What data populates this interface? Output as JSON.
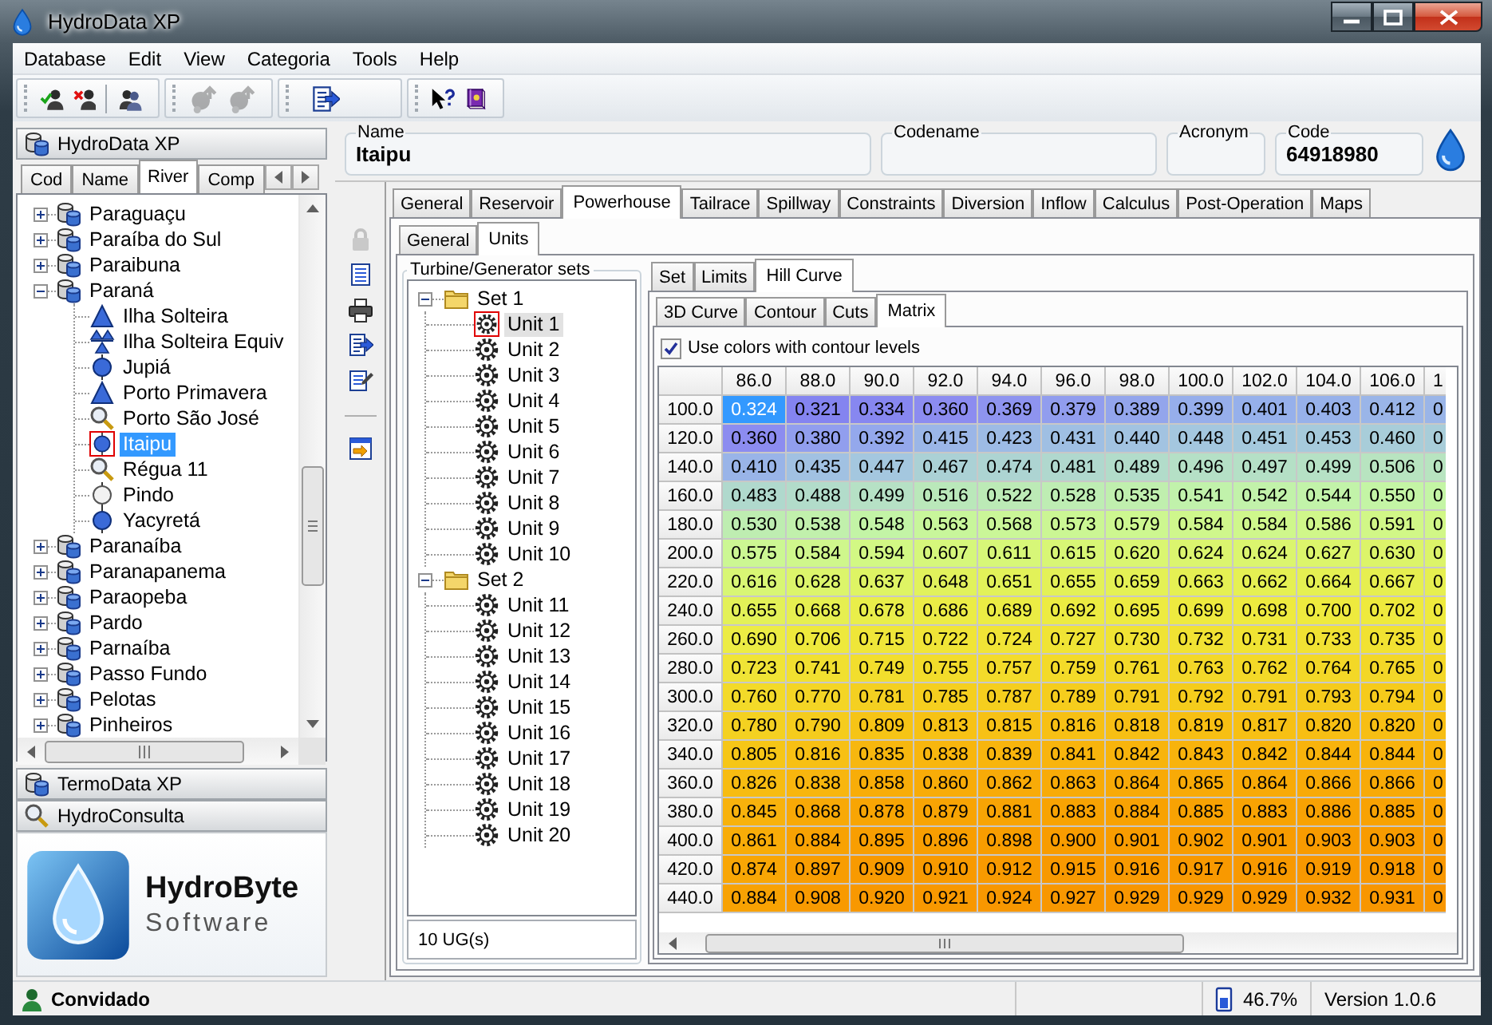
{
  "window": {
    "title": "HydroData XP"
  },
  "menu": {
    "items": [
      "Database",
      "Edit",
      "View",
      "Categoria",
      "Tools",
      "Help"
    ]
  },
  "toolbar": {
    "groups": [
      [
        {
          "disabled": false
        },
        {
          "disabled": false
        },
        {
          "disabled": false
        }
      ],
      [
        {
          "disabled": true
        },
        {
          "disabled": true
        }
      ],
      [
        {
          "disabled": false
        }
      ],
      [
        {
          "disabled": false
        },
        {
          "disabled": false
        }
      ]
    ]
  },
  "sidebar": {
    "title": "HydroData XP",
    "tabs": [
      {
        "label": "Cod",
        "selected": false
      },
      {
        "label": "Name",
        "selected": false
      },
      {
        "label": "River",
        "selected": true
      },
      {
        "label": "Comp",
        "selected": false
      }
    ],
    "tree": [
      {
        "label": "Paraguaçu",
        "expanded": false,
        "selected": false
      },
      {
        "label": "Paraíba do Sul",
        "expanded": false,
        "selected": false
      },
      {
        "label": "Paraibuna",
        "expanded": false,
        "selected": false
      },
      {
        "label": "Paraná",
        "expanded": true,
        "selected": false,
        "children": [
          {
            "label": "Ilha Solteira",
            "kind": "triangle",
            "selected": false
          },
          {
            "label": "Ilha Solteira Equiv",
            "kind": "twin_triangle",
            "selected": false
          },
          {
            "label": "Jupiá",
            "kind": "circle",
            "selected": false
          },
          {
            "label": "Porto Primavera",
            "kind": "triangle",
            "selected": false
          },
          {
            "label": "Porto São José",
            "kind": "magnifier",
            "selected": false
          },
          {
            "label": "Itaipu",
            "kind": "circle",
            "selected": true
          },
          {
            "label": "Régua 11",
            "kind": "magnifier",
            "selected": false
          },
          {
            "label": "Pindo",
            "kind": "hollow_circle",
            "selected": false
          },
          {
            "label": "Yacyretá",
            "kind": "circle",
            "selected": false
          }
        ]
      },
      {
        "label": "Paranaíba",
        "expanded": false,
        "selected": false
      },
      {
        "label": "Paranapanema",
        "expanded": false,
        "selected": false
      },
      {
        "label": "Paraopeba",
        "expanded": false,
        "selected": false
      },
      {
        "label": "Pardo",
        "expanded": false,
        "selected": false
      },
      {
        "label": "Parnaíba",
        "expanded": false,
        "selected": false
      },
      {
        "label": "Passo Fundo",
        "expanded": false,
        "selected": false
      },
      {
        "label": "Pelotas",
        "expanded": false,
        "selected": false
      },
      {
        "label": "Pinheiros",
        "expanded": false,
        "selected": false
      }
    ],
    "sections": [
      {
        "label": "TermoData XP"
      },
      {
        "label": "HydroConsulta"
      }
    ],
    "logo": {
      "name": "HydroByte",
      "tagline": "Software"
    }
  },
  "record": {
    "fields": [
      {
        "label": "Name",
        "value": "Itaipu"
      },
      {
        "label": "Codename"
      },
      {
        "label": "Acronym"
      },
      {
        "label": "Code",
        "value": "64918980"
      }
    ]
  },
  "side_toolbar": {
    "groups": [
      [
        {
          "disabled": true
        },
        {
          "disabled": false
        },
        {
          "disabled": false
        },
        {
          "disabled": false
        },
        {
          "disabled": false
        }
      ],
      [
        {
          "disabled": false
        }
      ]
    ]
  },
  "tabs": [
    {
      "label": "General",
      "selected": false
    },
    {
      "label": "Reservoir",
      "selected": false
    },
    {
      "label": "Powerhouse",
      "selected": true
    },
    {
      "label": "Tailrace",
      "selected": false
    },
    {
      "label": "Spillway",
      "selected": false
    },
    {
      "label": "Constraints",
      "selected": false
    },
    {
      "label": "Diversion",
      "selected": false
    },
    {
      "label": "Inflow",
      "selected": false
    },
    {
      "label": "Calculus",
      "selected": false
    },
    {
      "label": "Post-Operation",
      "selected": false
    },
    {
      "label": "Maps",
      "selected": false
    }
  ],
  "powerhouse_tabs": [
    {
      "label": "General",
      "selected": false
    },
    {
      "label": "Units",
      "selected": true
    }
  ],
  "units": {
    "title": "Turbine/Generator sets",
    "tree": [
      {
        "label": "Set 1",
        "expanded": true,
        "selected": false,
        "children": [
          {
            "label": "Unit 1",
            "selected": true
          },
          {
            "label": "Unit 2",
            "selected": false
          },
          {
            "label": "Unit 3",
            "selected": false
          },
          {
            "label": "Unit 4",
            "selected": false
          },
          {
            "label": "Unit 5",
            "selected": false
          },
          {
            "label": "Unit 6",
            "selected": false
          },
          {
            "label": "Unit 7",
            "selected": false
          },
          {
            "label": "Unit 8",
            "selected": false
          },
          {
            "label": "Unit 9",
            "selected": false
          },
          {
            "label": "Unit 10",
            "selected": false
          }
        ]
      },
      {
        "label": "Set 2",
        "expanded": true,
        "selected": false,
        "children": [
          {
            "label": "Unit 11",
            "selected": false
          },
          {
            "label": "Unit 12",
            "selected": false
          },
          {
            "label": "Unit 13",
            "selected": false
          },
          {
            "label": "Unit 14",
            "selected": false
          },
          {
            "label": "Unit 15",
            "selected": false
          },
          {
            "label": "Unit 16",
            "selected": false
          },
          {
            "label": "Unit 17",
            "selected": false
          },
          {
            "label": "Unit 18",
            "selected": false
          },
          {
            "label": "Unit 19",
            "selected": false
          },
          {
            "label": "Unit 20",
            "selected": false
          }
        ]
      }
    ],
    "footer": "10 UG(s)"
  },
  "unit_tabs": [
    {
      "label": "Set",
      "selected": false
    },
    {
      "label": "Limits",
      "selected": false
    },
    {
      "label": "Hill Curve",
      "selected": true
    }
  ],
  "hill_curve_tabs": [
    {
      "label": "3D Curve",
      "selected": false
    },
    {
      "label": "Contour",
      "selected": false
    },
    {
      "label": "Cuts",
      "selected": false
    },
    {
      "label": "Matrix",
      "selected": true
    }
  ],
  "use_colors": {
    "label": "Use colors with contour levels",
    "checked": true
  },
  "matrix": {
    "columns": [
      "86.0",
      "88.0",
      "90.0",
      "92.0",
      "94.0",
      "96.0",
      "98.0",
      "100.0",
      "102.0",
      "104.0",
      "106.0",
      "1"
    ],
    "rows": [
      {
        "label": "100.0",
        "cells": [
          {
            "value": "0.324",
            "selected": true
          },
          {
            "value": "0.321",
            "selected": false
          },
          {
            "value": "0.334",
            "selected": false
          },
          {
            "value": "0.360",
            "selected": false
          },
          {
            "value": "0.369",
            "selected": false
          },
          {
            "value": "0.379",
            "selected": false
          },
          {
            "value": "0.389",
            "selected": false
          },
          {
            "value": "0.399",
            "selected": false
          },
          {
            "value": "0.401",
            "selected": false
          },
          {
            "value": "0.403",
            "selected": false
          },
          {
            "value": "0.412",
            "selected": false
          },
          {
            "value": "0",
            "selected": false
          }
        ]
      },
      {
        "label": "120.0",
        "cells": [
          {
            "value": "0.360",
            "selected": false
          },
          {
            "value": "0.380",
            "selected": false
          },
          {
            "value": "0.392",
            "selected": false
          },
          {
            "value": "0.415",
            "selected": false
          },
          {
            "value": "0.423",
            "selected": false
          },
          {
            "value": "0.431",
            "selected": false
          },
          {
            "value": "0.440",
            "selected": false
          },
          {
            "value": "0.448",
            "selected": false
          },
          {
            "value": "0.451",
            "selected": false
          },
          {
            "value": "0.453",
            "selected": false
          },
          {
            "value": "0.460",
            "selected": false
          },
          {
            "value": "0",
            "selected": false
          }
        ]
      },
      {
        "label": "140.0",
        "cells": [
          {
            "value": "0.410",
            "selected": false
          },
          {
            "value": "0.435",
            "selected": false
          },
          {
            "value": "0.447",
            "selected": false
          },
          {
            "value": "0.467",
            "selected": false
          },
          {
            "value": "0.474",
            "selected": false
          },
          {
            "value": "0.481",
            "selected": false
          },
          {
            "value": "0.489",
            "selected": false
          },
          {
            "value": "0.496",
            "selected": false
          },
          {
            "value": "0.497",
            "selected": false
          },
          {
            "value": "0.499",
            "selected": false
          },
          {
            "value": "0.506",
            "selected": false
          },
          {
            "value": "0",
            "selected": false
          }
        ]
      },
      {
        "label": "160.0",
        "cells": [
          {
            "value": "0.483",
            "selected": false
          },
          {
            "value": "0.488",
            "selected": false
          },
          {
            "value": "0.499",
            "selected": false
          },
          {
            "value": "0.516",
            "selected": false
          },
          {
            "value": "0.522",
            "selected": false
          },
          {
            "value": "0.528",
            "selected": false
          },
          {
            "value": "0.535",
            "selected": false
          },
          {
            "value": "0.541",
            "selected": false
          },
          {
            "value": "0.542",
            "selected": false
          },
          {
            "value": "0.544",
            "selected": false
          },
          {
            "value": "0.550",
            "selected": false
          },
          {
            "value": "0",
            "selected": false
          }
        ]
      },
      {
        "label": "180.0",
        "cells": [
          {
            "value": "0.530",
            "selected": false
          },
          {
            "value": "0.538",
            "selected": false
          },
          {
            "value": "0.548",
            "selected": false
          },
          {
            "value": "0.563",
            "selected": false
          },
          {
            "value": "0.568",
            "selected": false
          },
          {
            "value": "0.573",
            "selected": false
          },
          {
            "value": "0.579",
            "selected": false
          },
          {
            "value": "0.584",
            "selected": false
          },
          {
            "value": "0.584",
            "selected": false
          },
          {
            "value": "0.586",
            "selected": false
          },
          {
            "value": "0.591",
            "selected": false
          },
          {
            "value": "0",
            "selected": false
          }
        ]
      },
      {
        "label": "200.0",
        "cells": [
          {
            "value": "0.575",
            "selected": false
          },
          {
            "value": "0.584",
            "selected": false
          },
          {
            "value": "0.594",
            "selected": false
          },
          {
            "value": "0.607",
            "selected": false
          },
          {
            "value": "0.611",
            "selected": false
          },
          {
            "value": "0.615",
            "selected": false
          },
          {
            "value": "0.620",
            "selected": false
          },
          {
            "value": "0.624",
            "selected": false
          },
          {
            "value": "0.624",
            "selected": false
          },
          {
            "value": "0.627",
            "selected": false
          },
          {
            "value": "0.630",
            "selected": false
          },
          {
            "value": "0",
            "selected": false
          }
        ]
      },
      {
        "label": "220.0",
        "cells": [
          {
            "value": "0.616",
            "selected": false
          },
          {
            "value": "0.628",
            "selected": false
          },
          {
            "value": "0.637",
            "selected": false
          },
          {
            "value": "0.648",
            "selected": false
          },
          {
            "value": "0.651",
            "selected": false
          },
          {
            "value": "0.655",
            "selected": false
          },
          {
            "value": "0.659",
            "selected": false
          },
          {
            "value": "0.663",
            "selected": false
          },
          {
            "value": "0.662",
            "selected": false
          },
          {
            "value": "0.664",
            "selected": false
          },
          {
            "value": "0.667",
            "selected": false
          },
          {
            "value": "0",
            "selected": false
          }
        ]
      },
      {
        "label": "240.0",
        "cells": [
          {
            "value": "0.655",
            "selected": false
          },
          {
            "value": "0.668",
            "selected": false
          },
          {
            "value": "0.678",
            "selected": false
          },
          {
            "value": "0.686",
            "selected": false
          },
          {
            "value": "0.689",
            "selected": false
          },
          {
            "value": "0.692",
            "selected": false
          },
          {
            "value": "0.695",
            "selected": false
          },
          {
            "value": "0.699",
            "selected": false
          },
          {
            "value": "0.698",
            "selected": false
          },
          {
            "value": "0.700",
            "selected": false
          },
          {
            "value": "0.702",
            "selected": false
          },
          {
            "value": "0",
            "selected": false
          }
        ]
      },
      {
        "label": "260.0",
        "cells": [
          {
            "value": "0.690",
            "selected": false
          },
          {
            "value": "0.706",
            "selected": false
          },
          {
            "value": "0.715",
            "selected": false
          },
          {
            "value": "0.722",
            "selected": false
          },
          {
            "value": "0.724",
            "selected": false
          },
          {
            "value": "0.727",
            "selected": false
          },
          {
            "value": "0.730",
            "selected": false
          },
          {
            "value": "0.732",
            "selected": false
          },
          {
            "value": "0.731",
            "selected": false
          },
          {
            "value": "0.733",
            "selected": false
          },
          {
            "value": "0.735",
            "selected": false
          },
          {
            "value": "0",
            "selected": false
          }
        ]
      },
      {
        "label": "280.0",
        "cells": [
          {
            "value": "0.723",
            "selected": false
          },
          {
            "value": "0.741",
            "selected": false
          },
          {
            "value": "0.749",
            "selected": false
          },
          {
            "value": "0.755",
            "selected": false
          },
          {
            "value": "0.757",
            "selected": false
          },
          {
            "value": "0.759",
            "selected": false
          },
          {
            "value": "0.761",
            "selected": false
          },
          {
            "value": "0.763",
            "selected": false
          },
          {
            "value": "0.762",
            "selected": false
          },
          {
            "value": "0.764",
            "selected": false
          },
          {
            "value": "0.765",
            "selected": false
          },
          {
            "value": "0",
            "selected": false
          }
        ]
      },
      {
        "label": "300.0",
        "cells": [
          {
            "value": "0.760",
            "selected": false
          },
          {
            "value": "0.770",
            "selected": false
          },
          {
            "value": "0.781",
            "selected": false
          },
          {
            "value": "0.785",
            "selected": false
          },
          {
            "value": "0.787",
            "selected": false
          },
          {
            "value": "0.789",
            "selected": false
          },
          {
            "value": "0.791",
            "selected": false
          },
          {
            "value": "0.792",
            "selected": false
          },
          {
            "value": "0.791",
            "selected": false
          },
          {
            "value": "0.793",
            "selected": false
          },
          {
            "value": "0.794",
            "selected": false
          },
          {
            "value": "0",
            "selected": false
          }
        ]
      },
      {
        "label": "320.0",
        "cells": [
          {
            "value": "0.780",
            "selected": false
          },
          {
            "value": "0.790",
            "selected": false
          },
          {
            "value": "0.809",
            "selected": false
          },
          {
            "value": "0.813",
            "selected": false
          },
          {
            "value": "0.815",
            "selected": false
          },
          {
            "value": "0.816",
            "selected": false
          },
          {
            "value": "0.818",
            "selected": false
          },
          {
            "value": "0.819",
            "selected": false
          },
          {
            "value": "0.817",
            "selected": false
          },
          {
            "value": "0.820",
            "selected": false
          },
          {
            "value": "0.820",
            "selected": false
          },
          {
            "value": "0",
            "selected": false
          }
        ]
      },
      {
        "label": "340.0",
        "cells": [
          {
            "value": "0.805",
            "selected": false
          },
          {
            "value": "0.816",
            "selected": false
          },
          {
            "value": "0.835",
            "selected": false
          },
          {
            "value": "0.838",
            "selected": false
          },
          {
            "value": "0.839",
            "selected": false
          },
          {
            "value": "0.841",
            "selected": false
          },
          {
            "value": "0.842",
            "selected": false
          },
          {
            "value": "0.843",
            "selected": false
          },
          {
            "value": "0.842",
            "selected": false
          },
          {
            "value": "0.844",
            "selected": false
          },
          {
            "value": "0.844",
            "selected": false
          },
          {
            "value": "0",
            "selected": false
          }
        ]
      },
      {
        "label": "360.0",
        "cells": [
          {
            "value": "0.826",
            "selected": false
          },
          {
            "value": "0.838",
            "selected": false
          },
          {
            "value": "0.858",
            "selected": false
          },
          {
            "value": "0.860",
            "selected": false
          },
          {
            "value": "0.862",
            "selected": false
          },
          {
            "value": "0.863",
            "selected": false
          },
          {
            "value": "0.864",
            "selected": false
          },
          {
            "value": "0.865",
            "selected": false
          },
          {
            "value": "0.864",
            "selected": false
          },
          {
            "value": "0.866",
            "selected": false
          },
          {
            "value": "0.866",
            "selected": false
          },
          {
            "value": "0",
            "selected": false
          }
        ]
      },
      {
        "label": "380.0",
        "cells": [
          {
            "value": "0.845",
            "selected": false
          },
          {
            "value": "0.868",
            "selected": false
          },
          {
            "value": "0.878",
            "selected": false
          },
          {
            "value": "0.879",
            "selected": false
          },
          {
            "value": "0.881",
            "selected": false
          },
          {
            "value": "0.883",
            "selected": false
          },
          {
            "value": "0.884",
            "selected": false
          },
          {
            "value": "0.885",
            "selected": false
          },
          {
            "value": "0.883",
            "selected": false
          },
          {
            "value": "0.886",
            "selected": false
          },
          {
            "value": "0.885",
            "selected": false
          },
          {
            "value": "0",
            "selected": false
          }
        ]
      },
      {
        "label": "400.0",
        "cells": [
          {
            "value": "0.861",
            "selected": false
          },
          {
            "value": "0.884",
            "selected": false
          },
          {
            "value": "0.895",
            "selected": false
          },
          {
            "value": "0.896",
            "selected": false
          },
          {
            "value": "0.898",
            "selected": false
          },
          {
            "value": "0.900",
            "selected": false
          },
          {
            "value": "0.901",
            "selected": false
          },
          {
            "value": "0.902",
            "selected": false
          },
          {
            "value": "0.901",
            "selected": false
          },
          {
            "value": "0.903",
            "selected": false
          },
          {
            "value": "0.903",
            "selected": false
          },
          {
            "value": "0",
            "selected": false
          }
        ]
      },
      {
        "label": "420.0",
        "cells": [
          {
            "value": "0.874",
            "selected": false
          },
          {
            "value": "0.897",
            "selected": false
          },
          {
            "value": "0.909",
            "selected": false
          },
          {
            "value": "0.910",
            "selected": false
          },
          {
            "value": "0.912",
            "selected": false
          },
          {
            "value": "0.915",
            "selected": false
          },
          {
            "value": "0.916",
            "selected": false
          },
          {
            "value": "0.917",
            "selected": false
          },
          {
            "value": "0.916",
            "selected": false
          },
          {
            "value": "0.919",
            "selected": false
          },
          {
            "value": "0.918",
            "selected": false
          },
          {
            "value": "0",
            "selected": false
          }
        ]
      },
      {
        "label": "440.0",
        "cells": [
          {
            "value": "0.884",
            "selected": false
          },
          {
            "value": "0.908",
            "selected": false
          },
          {
            "value": "0.920",
            "selected": false
          },
          {
            "value": "0.921",
            "selected": false
          },
          {
            "value": "0.924",
            "selected": false
          },
          {
            "value": "0.927",
            "selected": false
          },
          {
            "value": "0.929",
            "selected": false
          },
          {
            "value": "0.929",
            "selected": false
          },
          {
            "value": "0.929",
            "selected": false
          },
          {
            "value": "0.932",
            "selected": false
          },
          {
            "value": "0.931",
            "selected": false
          },
          {
            "value": "0",
            "selected": false
          }
        ]
      }
    ]
  },
  "status_bar": {
    "user": "Convidado",
    "memory": "46.7%",
    "version": "Version 1.0.6"
  }
}
